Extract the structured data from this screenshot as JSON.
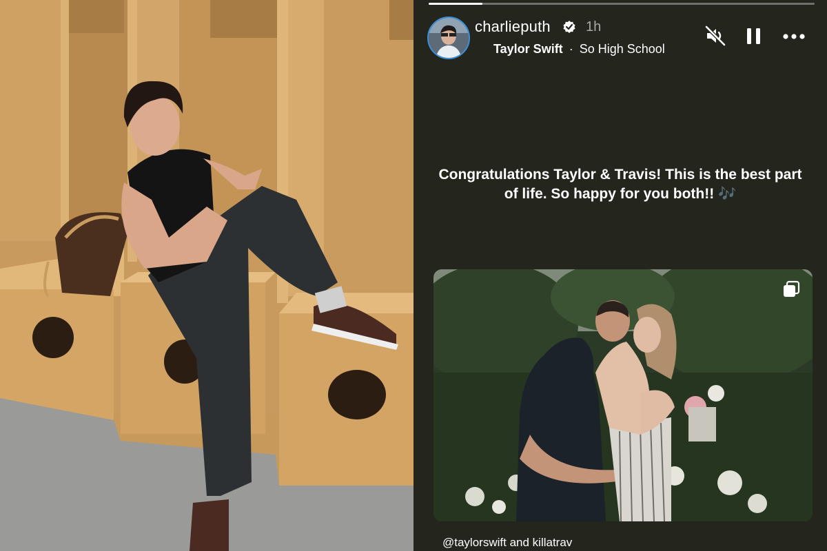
{
  "story": {
    "username": "charlieputh",
    "time_ago": "1h",
    "music": {
      "artist": "Taylor Swift",
      "separator": "·",
      "song": "So High School"
    },
    "progress": 0.14,
    "caption": "Congratulations Taylor & Travis! This is the best part of life. So happy for you both!!",
    "caption_emoji": "🎶",
    "mentions": {
      "first": "@taylorswift",
      "joiner": "and",
      "second": "killatrav"
    },
    "icons": {
      "verified": "verified-badge-icon",
      "mute": "speaker-muted-icon",
      "pause": "pause-icon",
      "more": "more-options-icon",
      "carousel": "carousel-icon"
    }
  },
  "colors": {
    "story_background": "#24261e",
    "avatar_ring": "#3a8fd8",
    "text_primary": "#ffffff"
  }
}
